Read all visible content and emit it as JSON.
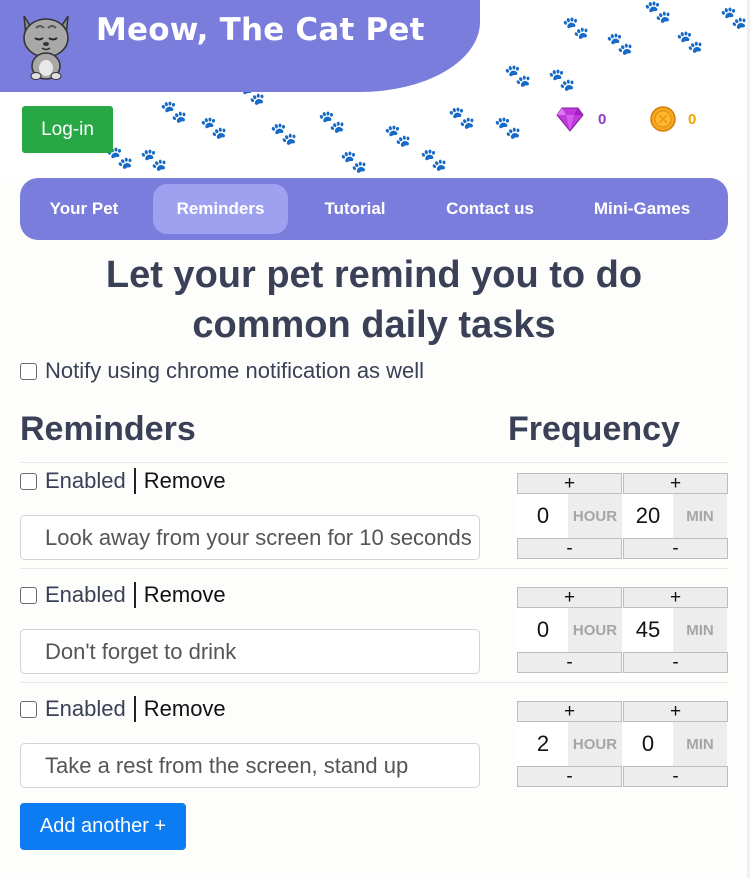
{
  "header": {
    "app_title": "Meow, The Cat Pet",
    "login_label": "Log-in",
    "gems": "0",
    "coins": "0",
    "colors": {
      "banner": "#7b7ddd",
      "gem": "#8a3cc5",
      "coin": "#f0a500",
      "login": "#28a745"
    }
  },
  "nav": {
    "tabs": [
      {
        "label": "Your Pet"
      },
      {
        "label": "Reminders",
        "active": true
      },
      {
        "label": "Tutorial"
      },
      {
        "label": "Contact us"
      },
      {
        "label": "Mini-Games"
      }
    ]
  },
  "page": {
    "heading_line1": "Let your pet remind you to do",
    "heading_line2": "common daily tasks",
    "notify_label": "Notify using chrome notification as well",
    "col_reminders": "Reminders",
    "col_frequency": "Frequency"
  },
  "reminders": [
    {
      "enabled_label": "Enabled",
      "remove_label": "Remove",
      "text": "Look away from your screen for 10 seconds",
      "hour": "0",
      "min": "20",
      "hour_unit": "HOUR",
      "min_unit": "MIN",
      "plus": "+",
      "minus": "-"
    },
    {
      "enabled_label": "Enabled",
      "remove_label": "Remove",
      "text": "Don't forget to drink",
      "hour": "0",
      "min": "45",
      "hour_unit": "HOUR",
      "min_unit": "MIN",
      "plus": "+",
      "minus": "-"
    },
    {
      "enabled_label": "Enabled",
      "remove_label": "Remove",
      "text": "Take a rest from the screen, stand up",
      "hour": "2",
      "min": "0",
      "hour_unit": "HOUR",
      "min_unit": "MIN",
      "plus": "+",
      "minus": "-"
    }
  ],
  "add_button": "Add another +",
  "icons": {
    "logo": "cat-logo-icon",
    "gem": "gem-icon",
    "coin": "coin-icon",
    "paw": "paw-print-icon"
  }
}
